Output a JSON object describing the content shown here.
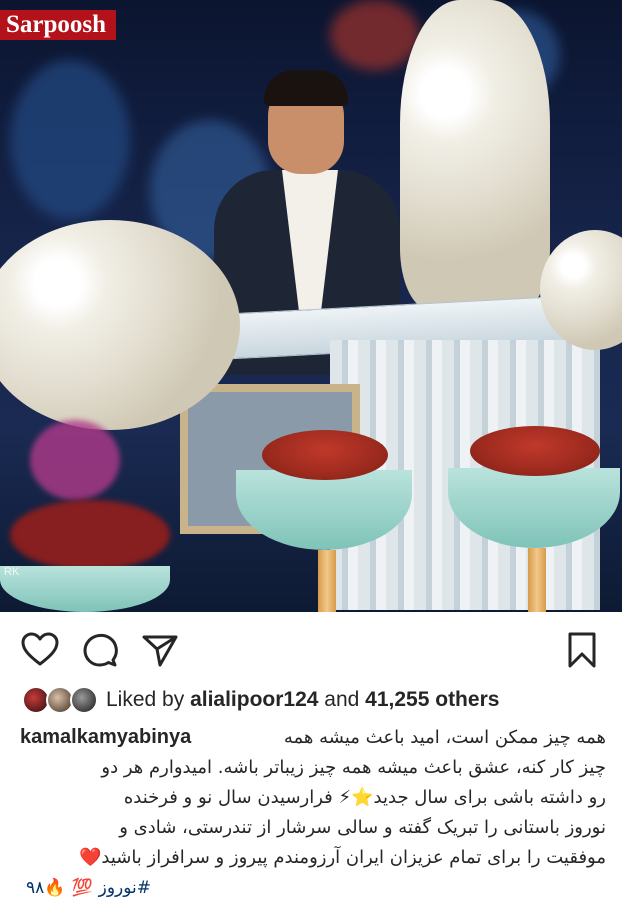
{
  "post": {
    "watermark": "Sarpoosh",
    "photo_watermark": "RK"
  },
  "actions": {
    "like_icon": "heart-outline-icon",
    "comment_icon": "comment-bubble-icon",
    "share_icon": "paper-plane-icon",
    "save_icon": "bookmark-icon"
  },
  "likes": {
    "prefix": "Liked by ",
    "user": "alialipoor124",
    "middle": " and ",
    "others": "41,255 others"
  },
  "caption": {
    "username": "kamalkamyabinya",
    "lines": [
      "همه چیز ممکن است،  امید باعث میشه همه",
      "چیز کار کنه،  عشق باعث میشه همه چیز زیباتر باشه.  امیدوارم هر دو",
      "رو داشته باشی برای سال جدید⭐⚡  فرارسیدن سال نو و فرخنده",
      "نوروز باستانی را تبریک گفته و سالی سرشار از تندرستی، شادی و",
      "موفقیت را برای تمام عزیزان ایران آرزومندم پیروز و سرافراز باشید❤️"
    ],
    "first_line_text": "همه چیز ممکن است،  امید باعث میشه همه",
    "tags": [
      "#نوروز",
      "💯",
      "🔥۹۸"
    ]
  }
}
